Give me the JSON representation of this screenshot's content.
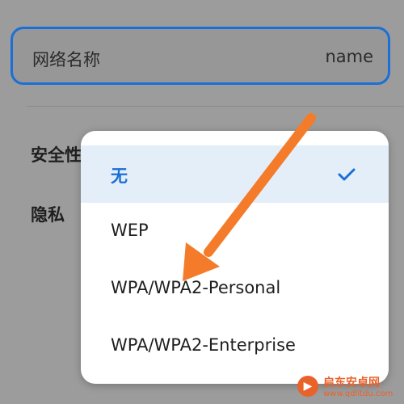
{
  "network_name_field": {
    "label": "网络名称",
    "value": "name",
    "accent_color": "#1a6fd8"
  },
  "rows": {
    "security_label": "安全性",
    "privacy_label": "隐私"
  },
  "security_dropdown": {
    "selected_value": "无",
    "options": [
      {
        "label": "无",
        "selected": true
      },
      {
        "label": "WEP",
        "selected": false
      },
      {
        "label": "WPA/WPA2-Personal",
        "selected": false
      },
      {
        "label": "WPA/WPA2-Enterprise",
        "selected": false
      }
    ],
    "check_icon": "check-icon"
  },
  "annotation": {
    "icon": "arrow-icon",
    "color": "#f47b2a",
    "points_to": "WPA/WPA2-Personal"
  },
  "watermark": {
    "title": "启东安卓网",
    "url": "www.qdlitdu.com",
    "logo_icon": "logo-icon",
    "color": "#e9622a"
  }
}
